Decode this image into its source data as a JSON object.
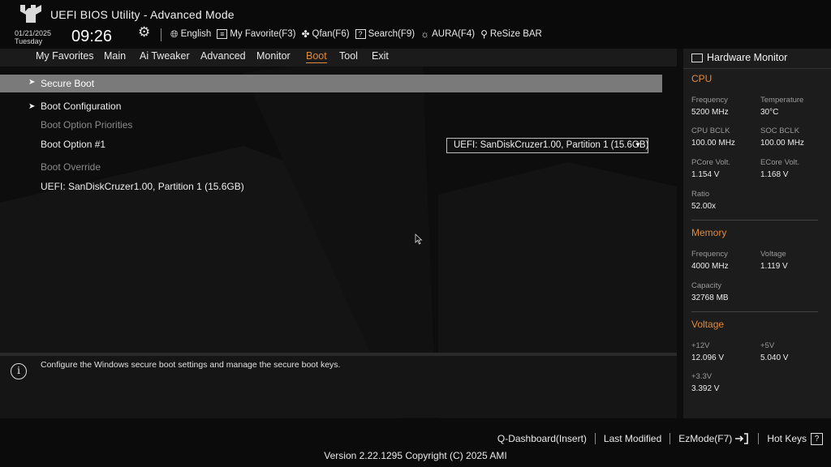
{
  "header": {
    "title": "UEFI BIOS Utility - Advanced Mode",
    "date": "01/21/2025",
    "weekday": "Tuesday",
    "time": "09:26",
    "toolbar": {
      "language": "English",
      "favorite": "My Favorite(F3)",
      "qfan": "Qfan(F6)",
      "search": "Search(F9)",
      "aura": "AURA(F4)",
      "resize_bar": "ReSize BAR"
    }
  },
  "menu": {
    "items": [
      "My Favorites",
      "Main",
      "Ai Tweaker",
      "Advanced",
      "Monitor",
      "Boot",
      "Tool",
      "Exit"
    ],
    "active": "Boot"
  },
  "boot": {
    "secure_boot": "Secure Boot",
    "boot_configuration": "Boot Configuration",
    "boot_option_priorities": "Boot Option Priorities",
    "boot_option_1_label": "Boot Option #1",
    "boot_option_1_value": "UEFI: SanDiskCruzer1.00, Partition 1 (15.6GB)",
    "boot_override": "Boot Override",
    "override_device": "UEFI: SanDiskCruzer1.00, Partition 1 (15.6GB)"
  },
  "help": {
    "text": "Configure the Windows secure boot settings and manage the secure boot keys."
  },
  "hardware_monitor": {
    "title": "Hardware Monitor",
    "cpu": {
      "section": "CPU",
      "frequency_label": "Frequency",
      "frequency": "5200 MHz",
      "temperature_label": "Temperature",
      "temperature": "30°C",
      "cpu_bclk_label": "CPU BCLK",
      "cpu_bclk": "100.00 MHz",
      "soc_bclk_label": "SOC BCLK",
      "soc_bclk": "100.00 MHz",
      "pcore_volt_label": "PCore Volt.",
      "pcore_volt": "1.154 V",
      "ecore_volt_label": "ECore Volt.",
      "ecore_volt": "1.168 V",
      "ratio_label": "Ratio",
      "ratio": "52.00x"
    },
    "memory": {
      "section": "Memory",
      "frequency_label": "Frequency",
      "frequency": "4000 MHz",
      "voltage_label": "Voltage",
      "voltage": "1.119 V",
      "capacity_label": "Capacity",
      "capacity": "32768 MB"
    },
    "voltage": {
      "section": "Voltage",
      "v12_label": "+12V",
      "v12": "12.096 V",
      "v5_label": "+5V",
      "v5": "5.040 V",
      "v33_label": "+3.3V",
      "v33": "3.392 V"
    }
  },
  "footer": {
    "q_dashboard": "Q-Dashboard(Insert)",
    "last_modified": "Last Modified",
    "ezmode": "EzMode(F7)",
    "hot_keys": "Hot Keys",
    "hot_keys_key": "?",
    "version": "Version 2.22.1295 Copyright (C) 2025 AMI"
  },
  "colors": {
    "accent": "#e08a3c",
    "highlight_row": "#7a7a7a",
    "background": "#0d0d0d"
  }
}
